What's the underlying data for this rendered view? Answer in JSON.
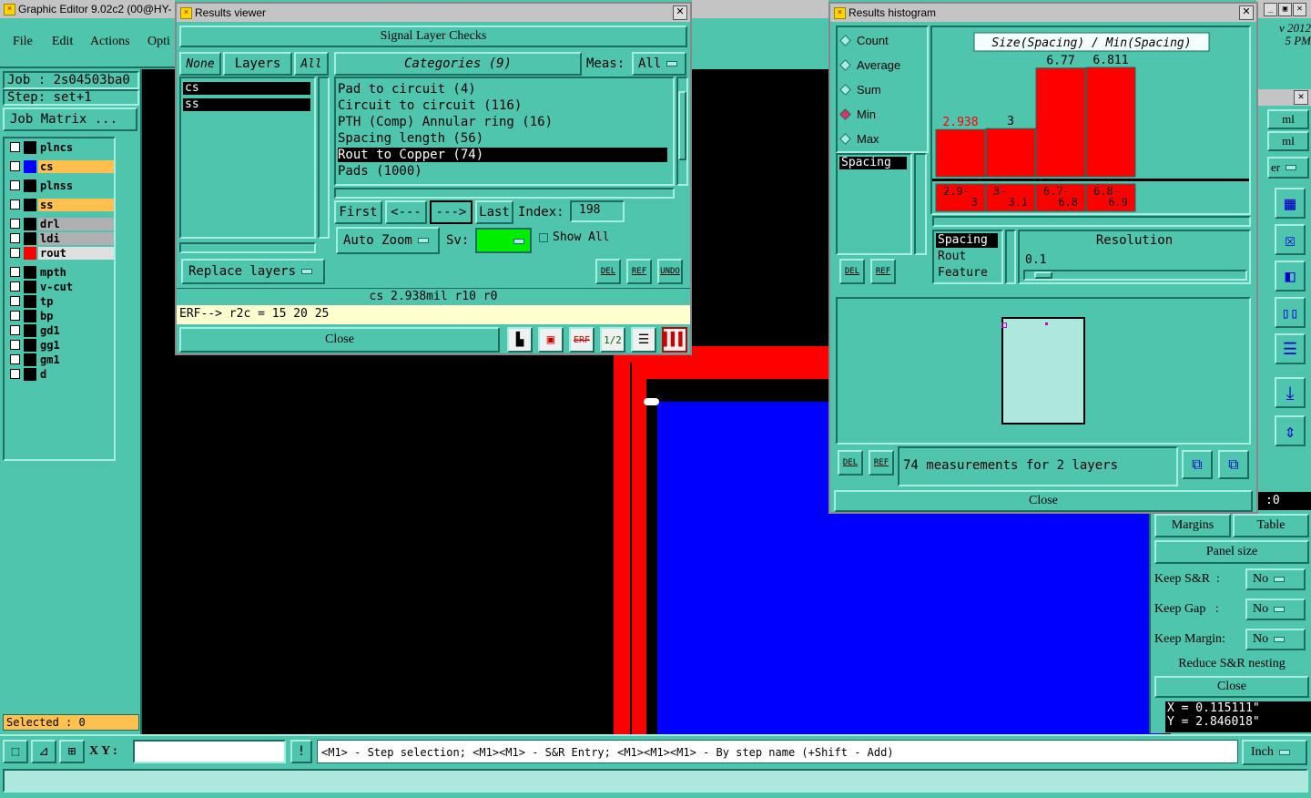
{
  "app": {
    "title": "Graphic Editor 9.02c2 (00@HY-",
    "menu": [
      "File",
      "Edit",
      "Actions",
      "Opti"
    ],
    "clock": "v 2012\n5 PM"
  },
  "left_panel": {
    "job": "Job : 2s04503ba0",
    "step": "Step: set+1",
    "job_matrix": "Job Matrix ...",
    "layers": [
      {
        "name": "plncs",
        "color": "#000000",
        "row_bg": "#4fc5ae"
      },
      {
        "name": "cs",
        "color": "#0000ff",
        "row_bg": "#ffc04d"
      },
      {
        "name": "plnss",
        "color": "#000000",
        "row_bg": "#4fc5ae"
      },
      {
        "name": "ss",
        "color": "#000000",
        "row_bg": "#ffc04d"
      },
      {
        "name": "drl",
        "color": "#000000",
        "row_bg": "#b0b0b0"
      },
      {
        "name": "ldi",
        "color": "#000000",
        "row_bg": "#b0b0b0"
      },
      {
        "name": "rout",
        "color": "#ff0000",
        "row_bg": "#e0e0e0"
      },
      {
        "name": "mpth",
        "color": "#000000",
        "row_bg": "#4fc5ae"
      },
      {
        "name": "v-cut",
        "color": "#000000",
        "row_bg": "#4fc5ae"
      },
      {
        "name": "tp",
        "color": "#000000",
        "row_bg": "#4fc5ae"
      },
      {
        "name": "bp",
        "color": "#000000",
        "row_bg": "#4fc5ae"
      },
      {
        "name": "gd1",
        "color": "#000000",
        "row_bg": "#4fc5ae"
      },
      {
        "name": "gg1",
        "color": "#000000",
        "row_bg": "#4fc5ae"
      },
      {
        "name": "gm1",
        "color": "#000000",
        "row_bg": "#4fc5ae"
      },
      {
        "name": "d",
        "color": "#000000",
        "row_bg": "#4fc5ae"
      }
    ],
    "selected": "Selected : 0"
  },
  "results_viewer": {
    "window_title": "Results viewer",
    "header": "Signal Layer Checks",
    "none_btn": "None",
    "layers_btn": "Layers",
    "all_btn": "All",
    "categories_btn": "Categories (9)",
    "meas_label": "Meas:",
    "meas_value": "All",
    "layer_list": [
      "cs",
      "ss"
    ],
    "categories": [
      "Pad to circuit (4)",
      "Circuit to circuit (116)",
      "PTH (Comp) Annular ring (16)",
      "Spacing length (56)",
      "Rout to Copper (74)",
      "Pads (1000)"
    ],
    "selected_category_index": 4,
    "first": "First",
    "prev": "<---",
    "next": "--->",
    "last": "Last",
    "index_label": "Index:",
    "index_value": "198",
    "auto_zoom": "Auto Zoom",
    "sv_label": "Sv:",
    "show_all": "Show All",
    "replace_layers": "Replace layers",
    "del": "DEL",
    "ref": "REF",
    "undo": "UNDO",
    "status": "cs 2.938mil  r10  r0",
    "erf": "ERF--> r2c = 15 20 25",
    "close": "Close"
  },
  "histogram": {
    "window_title": "Results histogram",
    "options": [
      "Count",
      "Average",
      "Sum",
      "Min",
      "Max"
    ],
    "selected_option": "Min",
    "measure_list": [
      "Spacing"
    ],
    "list2": [
      "Spacing",
      "Rout",
      "Feature"
    ],
    "resolution_label": "Resolution",
    "resolution_value": "0.1",
    "measurements": "74 measurements for 2 layers",
    "close": "Close",
    "del": "DEL",
    "ref": "REF"
  },
  "chart_data": {
    "type": "bar",
    "title": "Size(Spacing) / Min(Spacing)",
    "categories": [
      "2.9-3",
      "3-3.1",
      "6.7-6.8",
      "6.8-6.9"
    ],
    "category_lines": [
      [
        "2.9-",
        "3"
      ],
      [
        "3-",
        "3.1"
      ],
      [
        "6.7-",
        "6.8"
      ],
      [
        "6.8-",
        "6.9"
      ]
    ],
    "values": [
      2.938,
      3,
      6.77,
      6.811
    ],
    "value_labels": [
      "2.938",
      "3",
      "6.77",
      "6.811"
    ],
    "highlight_index": 0,
    "ylim": [
      0,
      6.811
    ],
    "bar_color": "#ff0000"
  },
  "right_panel": {
    "ml1": "ml",
    "ml2": "ml",
    "er": "er",
    "counter": ":0",
    "margins": "Margins",
    "table": "Table",
    "panel_size": "Panel size",
    "keep_sr_label": "Keep S&R  :",
    "keep_sr": "No",
    "keep_gap_label": "Keep Gap   :",
    "keep_gap": "No",
    "keep_margin_label": "Keep Margin:",
    "keep_margin": "No",
    "reduce": "Reduce S&R nesting",
    "close": "Close",
    "x_coord": "X = 0.115111\"",
    "y_coord": "Y = 2.846018\""
  },
  "bottom": {
    "xy_label": "X Y :",
    "xy_value": "",
    "hint": "<M1> - Step selection; <M1><M1> - S&R Entry; <M1><M1><M1> - By step name (+Shift - Add)",
    "units": "Inch"
  }
}
